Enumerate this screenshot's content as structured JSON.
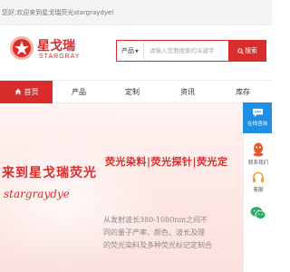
{
  "topbar": {
    "welcome": "您好,欢迎来到星戈瑞荧光stargraydye!"
  },
  "logo": {
    "name_cn": "星戈瑞",
    "name_en": "STARGRAY"
  },
  "search": {
    "category": "产品",
    "placeholder": "请输入您要搜索的关键字",
    "button_label": "搜索"
  },
  "nav": {
    "items": [
      {
        "label": "首页",
        "active": true
      },
      {
        "label": "产品"
      },
      {
        "label": "定制"
      },
      {
        "label": "资讯"
      },
      {
        "label": "库存"
      }
    ]
  },
  "banner": {
    "headline_right": "荧光染料|荧光探针|荧光定",
    "headline_left": "来到星戈瑞荧光",
    "brand": "stargraydye",
    "desc_lines": [
      "从发射波长380-1080nm之间不",
      "同的量子产率、颜色、波长及理",
      "的荧光染料及多种荧光标记定制合"
    ]
  },
  "sidebar": {
    "online_label": "在线咨询",
    "items": [
      {
        "label": "联系我们"
      },
      {
        "label": "客服"
      }
    ]
  },
  "colors": {
    "accent": "#d92c2c",
    "online": "#1e8fe3"
  }
}
